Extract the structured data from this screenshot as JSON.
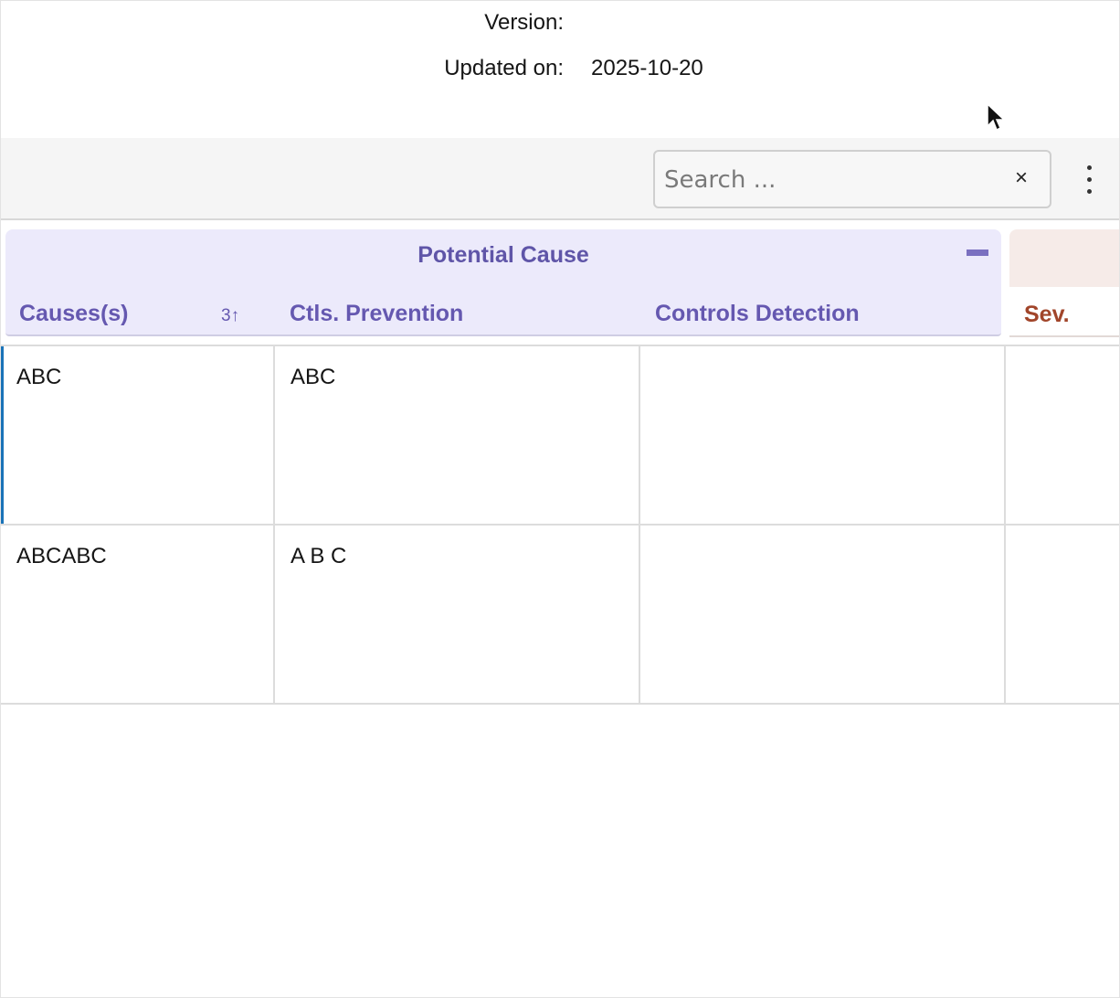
{
  "meta": {
    "version_label": "Version:",
    "version_value": "",
    "updated_label": "Updated on:",
    "updated_value": "2025-10-20"
  },
  "toolbar": {
    "search_placeholder": "Search ...",
    "clear_glyph": "×"
  },
  "group": {
    "title": "Potential Cause"
  },
  "columns": {
    "causes": "Causes(s)",
    "sort_indicator": "3↑",
    "prevention": "Ctls. Prevention",
    "detection": "Controls Detection",
    "severity": "Sev."
  },
  "rows": [
    {
      "causes": "ABC",
      "prevention": "ABC",
      "detection": "",
      "severity": ""
    },
    {
      "causes": "ABCABC",
      "prevention": "A B C",
      "detection": "",
      "severity": ""
    }
  ],
  "colors": {
    "accent": "#6558b0",
    "group_bg": "#eceafb",
    "severity": "#a1452a",
    "active_row": "#1a73b8"
  }
}
